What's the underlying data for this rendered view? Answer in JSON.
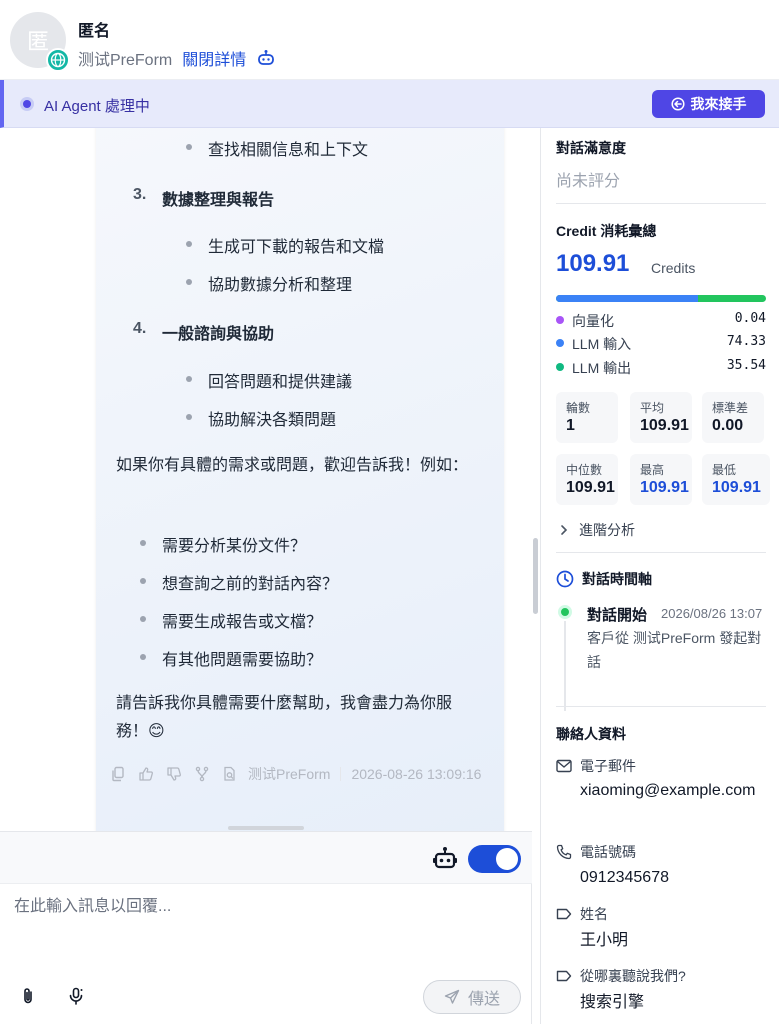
{
  "header": {
    "avatar_text": "匿",
    "contact_name": "匿名",
    "source_name": "测试PreForm",
    "close_details": "關閉詳情"
  },
  "status_bar": {
    "text": "AI Agent 處理中",
    "takeover_label": "我來接手"
  },
  "message": {
    "item_top": "查找相關信息和上下文",
    "sections": [
      {
        "num": "3.",
        "title": "數據整理與報告",
        "items": [
          "生成可下載的報告和文檔",
          "協助數據分析和整理"
        ]
      },
      {
        "num": "4.",
        "title": "一般諮詢與協助",
        "items": [
          "回答問題和提供建議",
          "協助解決各類問題"
        ]
      }
    ],
    "prompt": "如果你有具體的需求或問題，歡迎告訴我！例如：",
    "examples": [
      "需要分析某份文件？",
      "想查詢之前的對話內容？",
      "需要生成報告或文檔？",
      "有其他問題需要協助？"
    ],
    "closing": "請告訴我你具體需要什麼幫助，我會盡力為你服務！😊",
    "source": "测试PreForm",
    "timestamp": "2026-08-26 13:09:16"
  },
  "composer": {
    "placeholder": "在此輸入訊息以回覆...",
    "send_label": "傳送",
    "ai_toggle_on": true
  },
  "side_panel": {
    "satisfaction": {
      "title": "對話滿意度",
      "value": "尚未評分"
    },
    "credit": {
      "title": "Credit 消耗彙總",
      "total": "109.91",
      "unit": "Credits",
      "breakdown": [
        {
          "label": "向量化",
          "value": "0.04",
          "color": "#a855f7"
        },
        {
          "label": "LLM 輸入",
          "value": "74.33",
          "color": "#3b82f6"
        },
        {
          "label": "LLM 輸出",
          "value": "35.54",
          "color": "#10b981"
        }
      ],
      "stats": [
        {
          "label": "輪數",
          "value": "1"
        },
        {
          "label": "平均",
          "value": "109.91"
        },
        {
          "label": "標準差",
          "value": "0.00"
        },
        {
          "label": "中位數",
          "value": "109.91"
        },
        {
          "label": "最高",
          "value": "109.91"
        },
        {
          "label": "最低",
          "value": "109.91"
        }
      ],
      "advanced": "進階分析"
    },
    "timeline": {
      "title": "對話時間軸",
      "event_title": "對話開始",
      "event_time": "2026/08/26 13:07",
      "event_desc": "客戶從 测试PreForm 發起對話"
    },
    "contact": {
      "title": "聯絡人資料",
      "fields": [
        {
          "label": "電子郵件",
          "value": "xiaoming@example.com",
          "icon": "mail-icon"
        },
        {
          "label": "電話號碼",
          "value": "0912345678",
          "icon": "phone-icon"
        },
        {
          "label": "姓名",
          "value": "王小明",
          "icon": "tag-icon"
        },
        {
          "label": "從哪裏聽說我們?",
          "value": "搜索引擎",
          "icon": "tag-icon"
        }
      ]
    }
  },
  "colors": {
    "accent": "#4f46e5",
    "link": "#1d4ed8",
    "success": "#22c55e"
  }
}
